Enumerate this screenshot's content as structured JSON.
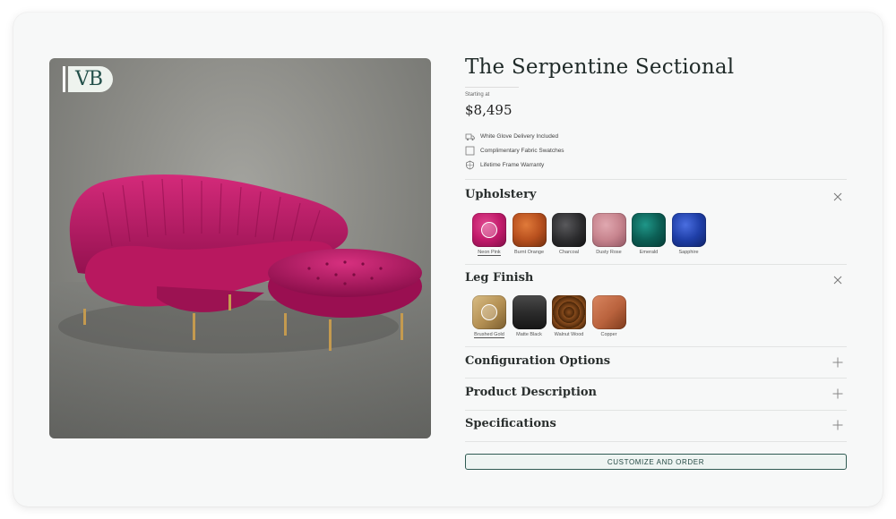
{
  "brand": {
    "logo_text": "VB"
  },
  "product": {
    "title": "The Serpentine Sectional",
    "price_caption": "Starting at",
    "price": "$8,495"
  },
  "features": [
    {
      "label": "White Glove Delivery Included",
      "icon": "truck-icon"
    },
    {
      "label": "Complimentary Fabric Swatches",
      "icon": "swatch-icon"
    },
    {
      "label": "Lifetime Frame Warranty",
      "icon": "shield-icon"
    }
  ],
  "upholstery": {
    "title": "Upholstery",
    "icon": "close-icon",
    "selected": "Neon Pink",
    "swatches": [
      {
        "label": "Neon Pink",
        "color": "#c21b6b"
      },
      {
        "label": "Burnt Orange",
        "color": "#b8501e"
      },
      {
        "label": "Charcoal",
        "color": "#2b2b2d"
      },
      {
        "label": "Dusty Rose",
        "color": "#c7848e"
      },
      {
        "label": "Emerald",
        "color": "#0c5f55"
      },
      {
        "label": "Sapphire",
        "color": "#1f3fa8"
      }
    ]
  },
  "leg_finish": {
    "title": "Leg Finish",
    "icon": "close-icon",
    "selected": "Brushed Gold",
    "swatches": [
      {
        "label": "Brushed Gold",
        "color": "#b38f52"
      },
      {
        "label": "Matte Black",
        "color": "#2c2c2c"
      },
      {
        "label": "Walnut Wood",
        "color": "#6b3a14"
      },
      {
        "label": "Copper",
        "color": "#b9623d"
      }
    ]
  },
  "accordions": [
    {
      "title": "Configuration Options",
      "icon": "plus-icon"
    },
    {
      "title": "Product Description",
      "icon": "plus-icon"
    },
    {
      "title": "Specifications",
      "icon": "plus-icon"
    }
  ],
  "cta": {
    "label": "CUSTOMIZE AND ORDER"
  },
  "colors": {
    "accent": "#2f5a52",
    "sofa": "#c21b6b",
    "leg": "#c49a4f"
  }
}
